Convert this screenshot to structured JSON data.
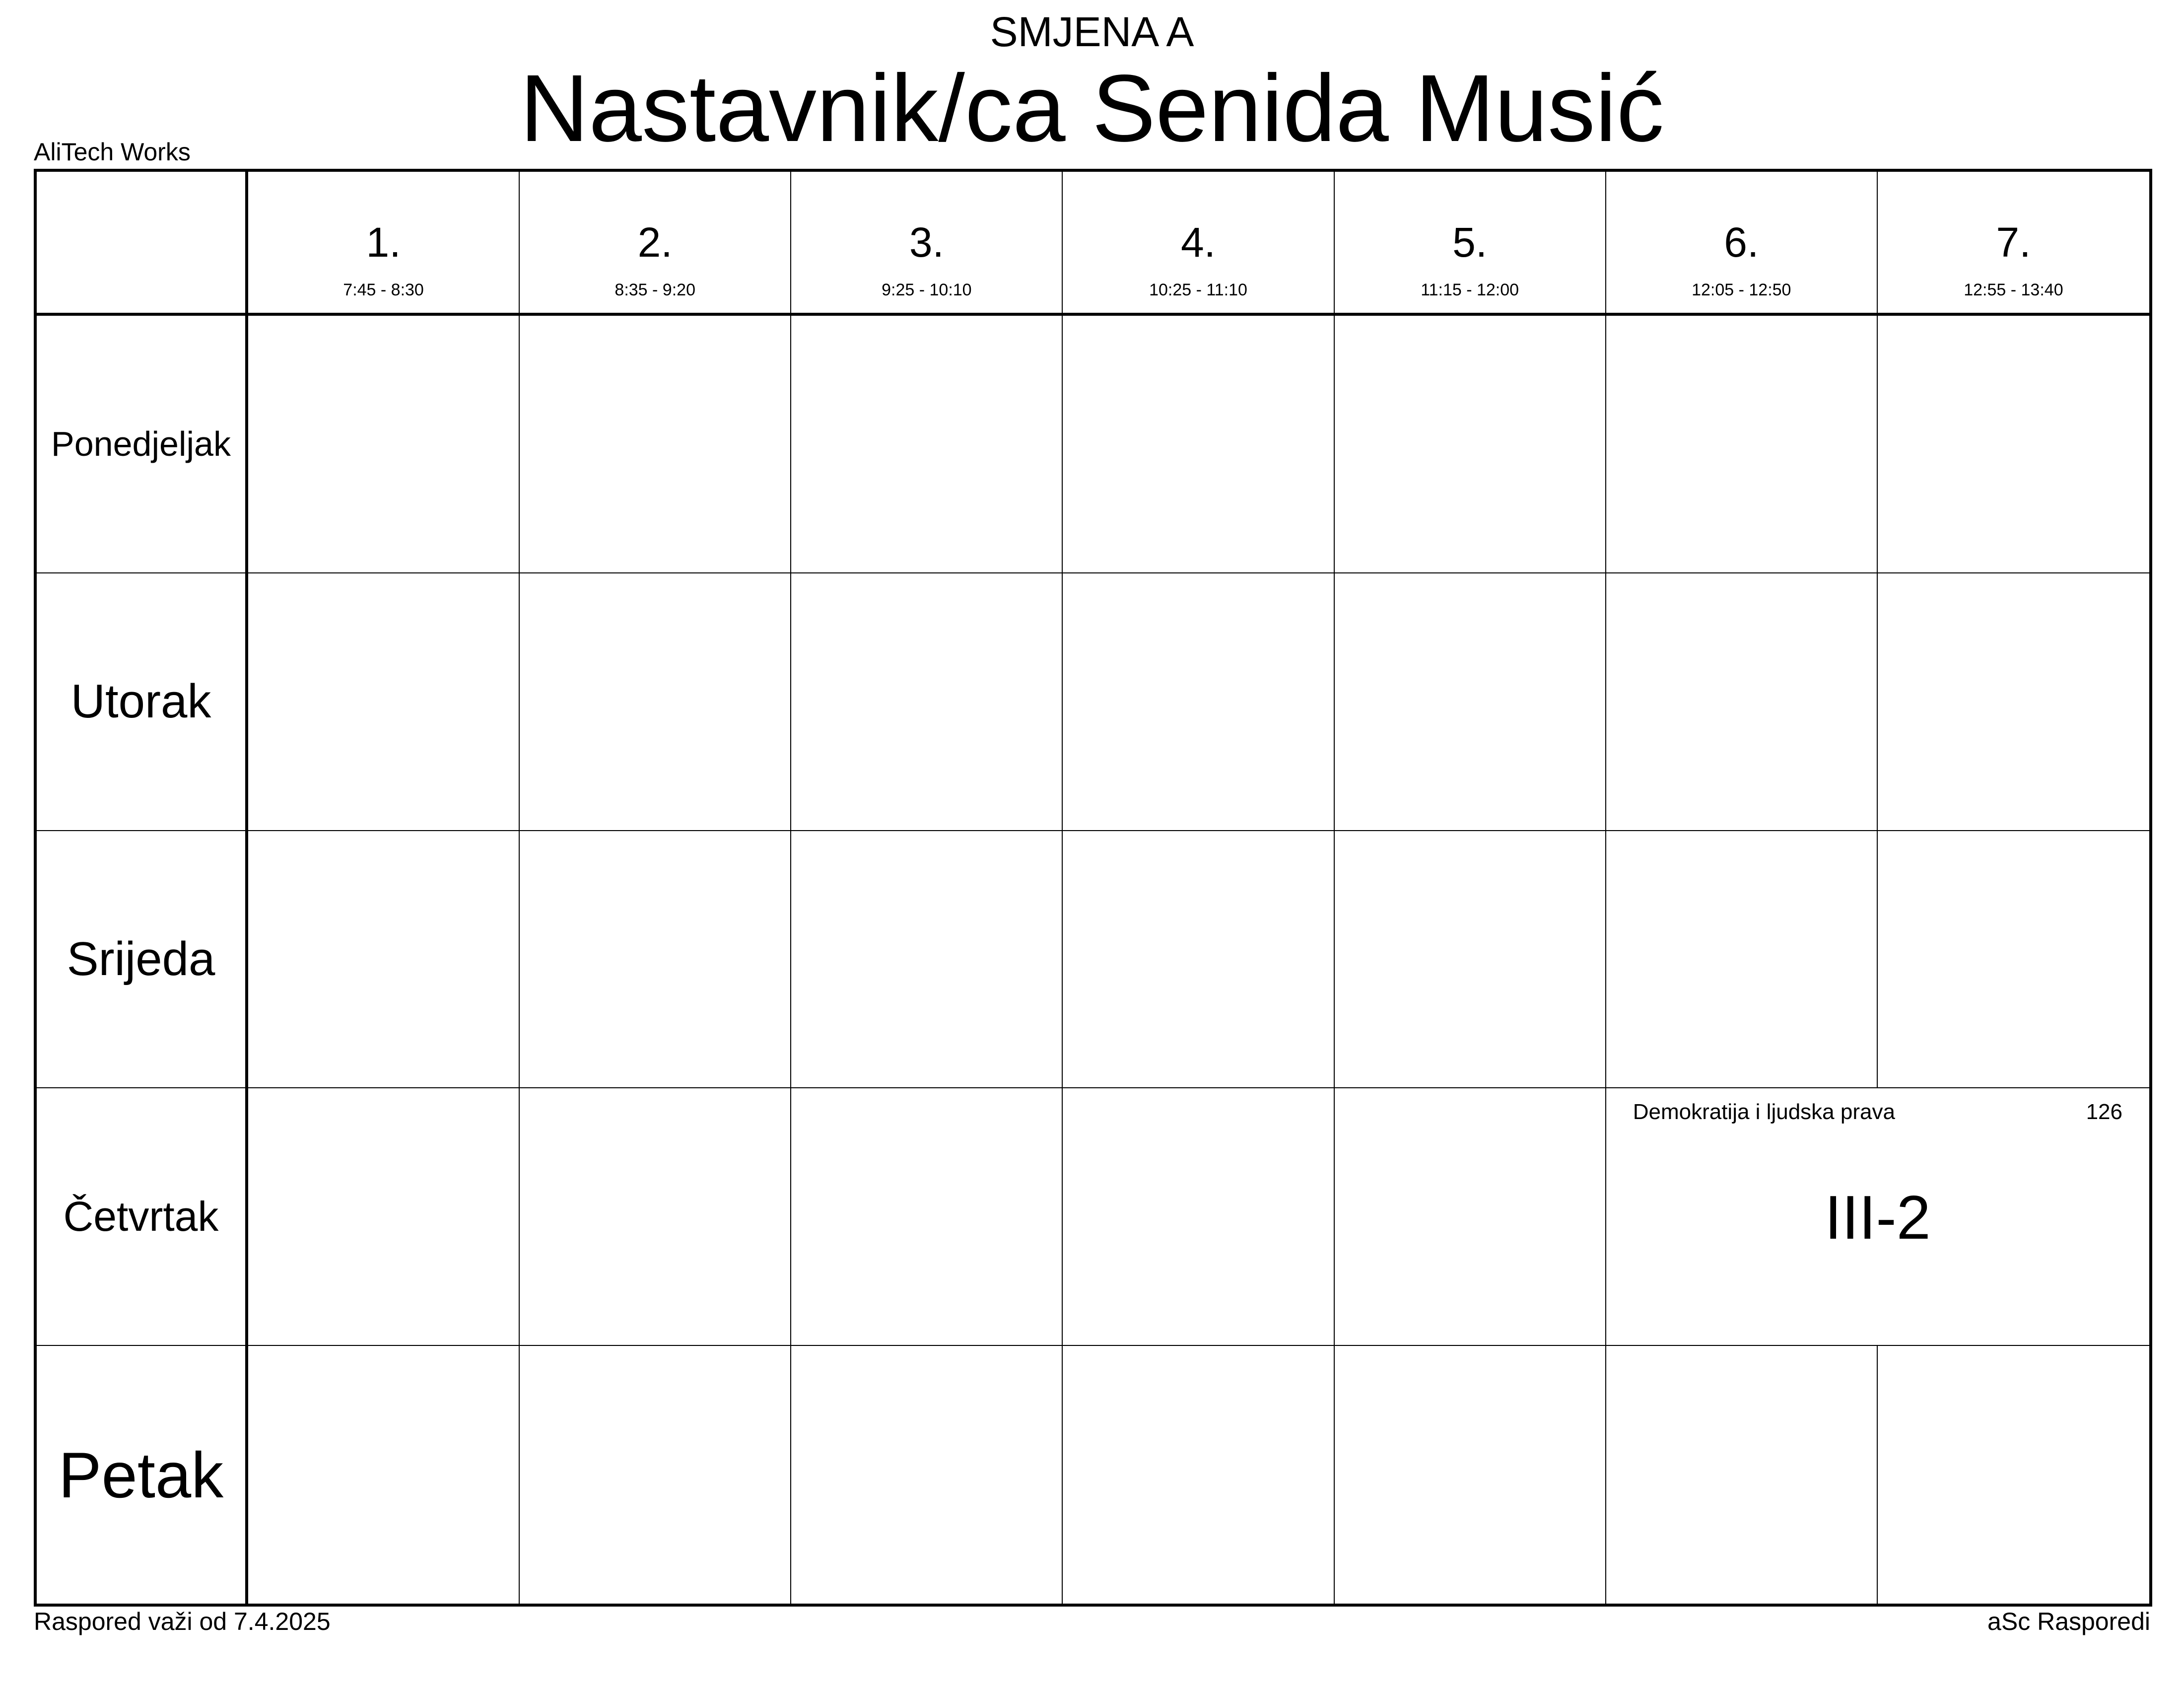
{
  "header": {
    "shift": "SMJENA A",
    "title": "Nastavnik/ca Senida Musić",
    "school": "AliTech Works"
  },
  "periods": [
    {
      "num": "1.",
      "time": "7:45 - 8:30"
    },
    {
      "num": "2.",
      "time": "8:35 - 9:20"
    },
    {
      "num": "3.",
      "time": "9:25 - 10:10"
    },
    {
      "num": "4.",
      "time": "10:25 - 11:10"
    },
    {
      "num": "5.",
      "time": "11:15 - 12:00"
    },
    {
      "num": "6.",
      "time": "12:05 - 12:50"
    },
    {
      "num": "7.",
      "time": "12:55 - 13:40"
    }
  ],
  "days": [
    "Ponedjeljak",
    "Utorak",
    "Srijeda",
    "Četvrtak",
    "Petak"
  ],
  "lesson": {
    "day": "Četvrtak",
    "periods": [
      "6.",
      "7."
    ],
    "subject": "Demokratija i ljudska prava",
    "room": "126",
    "class": "III-2"
  },
  "footer": {
    "valid_from": "Raspored važi od 7.4.2025",
    "software": "aSc Rasporedi"
  }
}
